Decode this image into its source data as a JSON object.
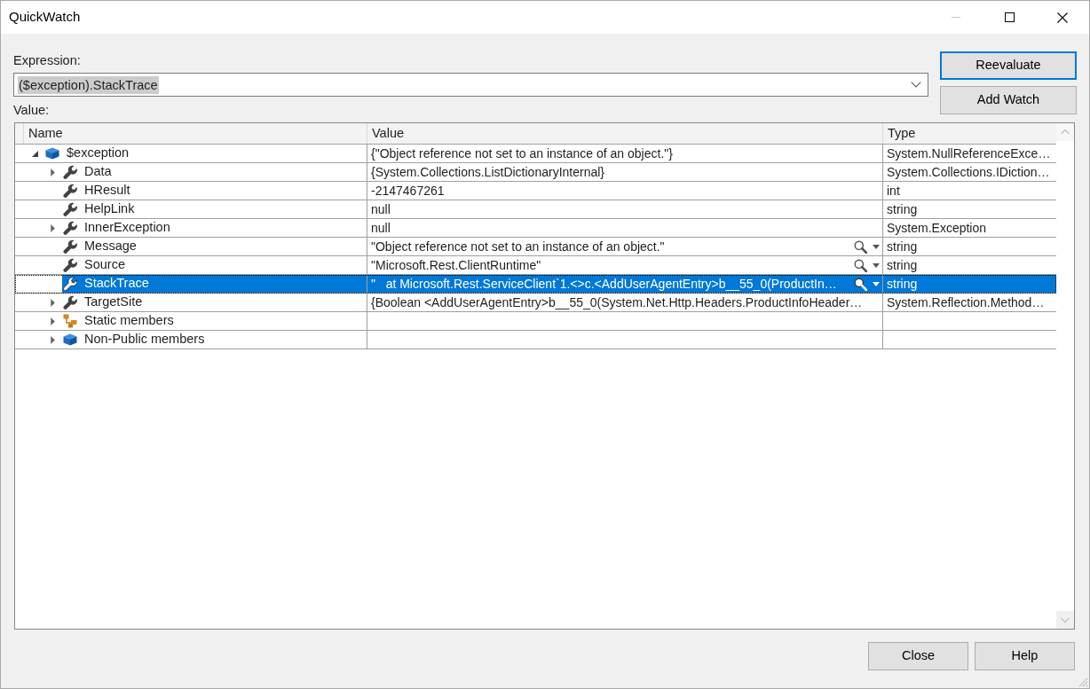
{
  "window": {
    "title": "QuickWatch",
    "controls": [
      {
        "kind": "minimize",
        "disabled": true
      },
      {
        "kind": "maximize",
        "disabled": false
      },
      {
        "kind": "close",
        "disabled": false
      }
    ]
  },
  "expression": {
    "label": "Expression:",
    "value": "($exception).StackTrace",
    "text_selected": true
  },
  "side_buttons": [
    {
      "label": "Reevaluate",
      "default": true
    },
    {
      "label": "Add Watch",
      "default": false
    }
  ],
  "value_label": "Value:",
  "table": {
    "columns": [
      "Name",
      "Value",
      "Type"
    ],
    "rows": [
      {
        "name": "$exception",
        "kind": "object",
        "expandable": true,
        "expanded": true,
        "value": "{\"Object reference not set to an instance of an object.\"}",
        "type": "System.NullReferenceExce…",
        "visualizer": false,
        "selected": false,
        "children": [
          {
            "name": "Data",
            "kind": "property",
            "expandable": true,
            "expanded": false,
            "value": "{System.Collections.ListDictionaryInternal}",
            "type": "System.Collections.IDiction…",
            "visualizer": false,
            "selected": false
          },
          {
            "name": "HResult",
            "kind": "property",
            "expandable": false,
            "value": "-2147467261",
            "type": "int",
            "visualizer": false,
            "selected": false
          },
          {
            "name": "HelpLink",
            "kind": "property",
            "expandable": false,
            "value": "null",
            "type": "string",
            "visualizer": false,
            "selected": false
          },
          {
            "name": "InnerException",
            "kind": "property",
            "expandable": true,
            "expanded": false,
            "value": "null",
            "type": "System.Exception",
            "visualizer": false,
            "selected": false
          },
          {
            "name": "Message",
            "kind": "property",
            "expandable": false,
            "value": "\"Object reference not set to an instance of an object.\"",
            "type": "string",
            "visualizer": true,
            "selected": false
          },
          {
            "name": "Source",
            "kind": "property",
            "expandable": false,
            "value": "\"Microsoft.Rest.ClientRuntime\"",
            "type": "string",
            "visualizer": true,
            "selected": false
          },
          {
            "name": "StackTrace",
            "kind": "property",
            "expandable": false,
            "value": "\"   at Microsoft.Rest.ServiceClient`1.<>c.<AddUserAgentEntry>b__55_0(ProductIn…",
            "type": "string",
            "visualizer": true,
            "selected": true
          },
          {
            "name": "TargetSite",
            "kind": "property",
            "expandable": true,
            "expanded": false,
            "value": "{Boolean <AddUserAgentEntry>b__55_0(System.Net.Http.Headers.ProductInfoHeader…",
            "type": "System.Reflection.Method…",
            "visualizer": false,
            "selected": false
          },
          {
            "name": "Static members",
            "kind": "static",
            "expandable": true,
            "expanded": false,
            "visualizer": false,
            "selected": false
          },
          {
            "name": "Non-Public members",
            "kind": "object",
            "expandable": true,
            "expanded": false,
            "visualizer": false,
            "selected": false
          }
        ]
      }
    ]
  },
  "footer_buttons": [
    {
      "label": "Close",
      "default": false
    },
    {
      "label": "Help",
      "default": false
    }
  ]
}
